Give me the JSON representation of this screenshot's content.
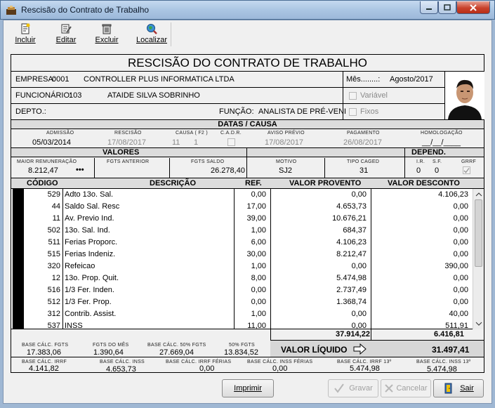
{
  "window": {
    "title": "Rescisão do Contrato de Trabalho"
  },
  "toolbar": {
    "incluir": "Incluir",
    "editar": "Editar",
    "excluir": "Excluir",
    "localizar": "Localizar"
  },
  "form": {
    "title": "RESCISÃO DO CONTRATO DE TRABALHO",
    "empresa_label": "EMPRESA:",
    "empresa_code": "0001",
    "empresa_name": "CONTROLLER PLUS INFORMATICA LTDA",
    "mes_label": "Mês........:",
    "mes_value": "Agosto/2017",
    "funcionario_label": "FUNCIONÁRIO:",
    "funcionario_code": "103",
    "funcionario_name": "ATAIDE SILVA SOBRINHO",
    "variavel_label": "Variável",
    "depto_label": "DEPTO.:",
    "funcao_label": "FUNÇÃO:",
    "funcao_value": "ANALISTA DE PRÉ-VENI",
    "fixos_label": "Fixos"
  },
  "datas": {
    "band": "DATAS / CAUSA",
    "admissao_label": "ADMISSÃO",
    "admissao": "05/03/2014",
    "rescisao_label": "RESCISÃO",
    "rescisao": "17/08/2017",
    "causa_label": "CAUSA ( F2 )",
    "causa_a": "11",
    "causa_b": "1",
    "cadr_label": "C.A.D.R.",
    "aviso_label": "AVISO PRÉVIO",
    "aviso": "17/08/2017",
    "pagamento_label": "PAGAMENTO",
    "pagamento": "26/08/2017",
    "homologacao_label": "HOMOLOGAÇÃO",
    "homologacao": "__/__/____"
  },
  "valores": {
    "band": "VALORES",
    "depend_band": "DEPEND.",
    "maior_rem_label": "MAIOR REMUNERAÇÃO",
    "maior_rem": "8.212,47",
    "more": "•••",
    "fgts_anterior_label": "FGTS ANTERIOR",
    "fgts_saldo_label": "FGTS SALDO",
    "fgts_saldo": "26.278,40",
    "motivo_label": "MOTIVO",
    "motivo": "SJ2",
    "tipo_caged_label": "TIPO CAGED",
    "tipo_caged": "31",
    "ir_label": "I.R.",
    "ir": "0",
    "sf_label": "S.F.",
    "sf": "0",
    "grrf_label": "GRRF"
  },
  "table": {
    "headers": [
      "CÓDIGO",
      "DESCRIÇÃO",
      "REF.",
      "VALOR PROVENTO",
      "VALOR DESCONTO"
    ],
    "rows": [
      {
        "codigo": "529",
        "descricao": "Adto 13o. Sal.",
        "ref": "0,00",
        "provento": "0,00",
        "desconto": "4.106,23"
      },
      {
        "codigo": "44",
        "descricao": "Saldo Sal. Resc",
        "ref": "17,00",
        "provento": "4.653,73",
        "desconto": "0,00"
      },
      {
        "codigo": "11",
        "descricao": "Av. Previo Ind.",
        "ref": "39,00",
        "provento": "10.676,21",
        "desconto": "0,00"
      },
      {
        "codigo": "502",
        "descricao": "13o. Sal. Ind.",
        "ref": "1,00",
        "provento": "684,37",
        "desconto": "0,00"
      },
      {
        "codigo": "511",
        "descricao": "Ferias Proporc.",
        "ref": "6,00",
        "provento": "4.106,23",
        "desconto": "0,00"
      },
      {
        "codigo": "515",
        "descricao": "Ferias Indeniz.",
        "ref": "30,00",
        "provento": "8.212,47",
        "desconto": "0,00"
      },
      {
        "codigo": "320",
        "descricao": "Refeicao",
        "ref": "1,00",
        "provento": "0,00",
        "desconto": "390,00"
      },
      {
        "codigo": "12",
        "descricao": "13o. Prop. Quit.",
        "ref": "8,00",
        "provento": "5.474,98",
        "desconto": "0,00"
      },
      {
        "codigo": "516",
        "descricao": "1/3 Fer. Inden.",
        "ref": "0,00",
        "provento": "2.737,49",
        "desconto": "0,00"
      },
      {
        "codigo": "512",
        "descricao": "1/3 Fer. Prop.",
        "ref": "0,00",
        "provento": "1.368,74",
        "desconto": "0,00"
      },
      {
        "codigo": "312",
        "descricao": "Contrib. Assist.",
        "ref": "1,00",
        "provento": "0,00",
        "desconto": "40,00"
      },
      {
        "codigo": "537",
        "descricao": "INSS",
        "ref": "11,00",
        "provento": "0,00",
        "desconto": "511,91"
      }
    ],
    "total_provento": "37.914,22",
    "total_desconto": "6.416,81",
    "liquido_label": "VALOR LÍQUIDO",
    "liquido": "31.497,41"
  },
  "bases": {
    "fgts_label": "BASE CÁLC. FGTS",
    "fgts": "17.383,06",
    "fgts_mes_label": "FGTS DO MÊS",
    "fgts_mes": "1.390,64",
    "fgts50_label": "BASE CÁLC. 50% FGTS",
    "fgts50": "27.669,04",
    "p50_label": "50% FGTS",
    "p50": "13.834,52",
    "irrf_label": "BASE CÁLC. IRRF",
    "irrf": "4.141,82",
    "inss_label": "BASE CÁLC. INSS",
    "inss": "4.653,73",
    "irrf_ferias_label": "BASE CÁLC. IRRF FÉRIAS",
    "irrf_ferias": "0,00",
    "inss_ferias_label": "BASE CÁLC. INSS FÉRIAS",
    "inss_ferias": "0,00",
    "irrf13_label": "BASE CÁLC. IRRF 13º",
    "irrf13": "5.474,98",
    "inss13_label": "BASE CÁLC. INSS 13º",
    "inss13": "5.474,98"
  },
  "buttons": {
    "imprimir": "Imprimir",
    "gravar": "Gravar",
    "cancelar": "Cancelar",
    "sair": "Sair"
  }
}
